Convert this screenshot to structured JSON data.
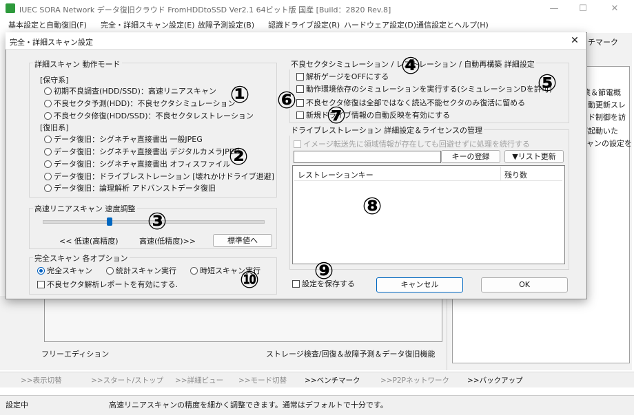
{
  "app": {
    "title": "IUEC SORA Network データ復旧クラウド FromHDDtoSSD Ver2.1 64ビット版 国産 [Build：2820 Rev.8]",
    "minimize": "—",
    "maximize": "☐",
    "close": "✕"
  },
  "menu": [
    "基本設定と自動復旧(F)",
    "完全・詳細スキャン設定(E)",
    "故障予測設定(B)",
    "認識ドライブ設定(R)",
    "ハードウェア設定(D)",
    "通信設定とヘルプ(H)"
  ],
  "background": {
    "side_tab": "ンチマーク",
    "side_lines": [
      "業＆節電概",
      "自動更新スレ",
      "ンド制御を訪",
      "が起動いた",
      "キャンの設定を"
    ],
    "edition": "フリーエディション",
    "tagline": "ストレージ検査/回復＆故障予測＆データ復旧機能"
  },
  "nav": [
    ">>表示切替",
    ">>スタート/ストップ",
    ">>詳細ビュー",
    ">>モード切替",
    ">>ベンチマーク",
    ">>P2Pネットワーク",
    ">>バックアップ"
  ],
  "status": {
    "left": "設定中",
    "message": "高速リニアスキャンの精度を細かく調整できます。通常はデフォルトで十分です。"
  },
  "dialog": {
    "title": "完全・詳細スキャン設定",
    "close": "✕",
    "mode_group": {
      "label": "詳細スキャン 動作モード",
      "maintenance_header": "[保守系]",
      "maintenance": [
        "初期不良調査(HDD/SSD)：高速リニアスキャン",
        "不良セクタ予測(HDD)：不良セクタシミュレーション",
        "不良セクタ修復(HDD/SSD)：不良セクタレストレーション"
      ],
      "recovery_header": "[復旧系]",
      "recovery": [
        "データ復旧：シグネチャ直接書出 一般JPEG",
        "データ復旧：シグネチャ直接書出 デジタルカメラJPEG",
        "データ復旧：シグネチャ直接書出 オフィスファイル",
        "データ復旧：ドライブレストレーション [壊れかけドライブ退避]",
        "データ復旧：論理解析 アドバンストデータ復旧"
      ]
    },
    "speed_group": {
      "label": "高速リニアスキャン 速度調整",
      "slow": "<< 低速(高精度)",
      "fast": "高速(低精度)>>",
      "default_button": "標準値へ",
      "level": 0.3
    },
    "full_group": {
      "label": "完全スキャン 各オプション",
      "options": [
        "完全スキャン",
        "統計スキャン実行",
        "時短スキャン実行"
      ],
      "selected": "完全スキャン",
      "report_checkbox": "不良セクタ解析レポートを有効にする."
    },
    "sim_group": {
      "label": "不良セクタシミュレーション / レストレーション / 自動再構築 詳細設定",
      "checks": [
        "解析ゲージをOFFにする",
        "動作環境依存のシミュレーションを実行する(シミュレーションDを許可)",
        "不良セクタ修復は全部ではなく読込不能セクタのみ復活に留める",
        "新規ドライブ情報の自動反映を有効にする"
      ]
    },
    "license_group": {
      "label": "ドライブレストレーション 詳細設定＆ライセンスの管理",
      "ignore_checkbox": "イメージ転送先に領域情報が存在しても回避せずに処理を続行する",
      "register_button": "キーの登録",
      "refresh_button": "▼リスト更新",
      "columns": [
        "レストレーションキー",
        "残り数"
      ]
    },
    "save_checkbox": "設定を保存する",
    "cancel_button": "キャンセル",
    "ok_button": "OK"
  },
  "markers": [
    "①",
    "②",
    "③",
    "④",
    "⑤",
    "⑥",
    "⑦",
    "⑧",
    "⑨",
    "⑩"
  ]
}
